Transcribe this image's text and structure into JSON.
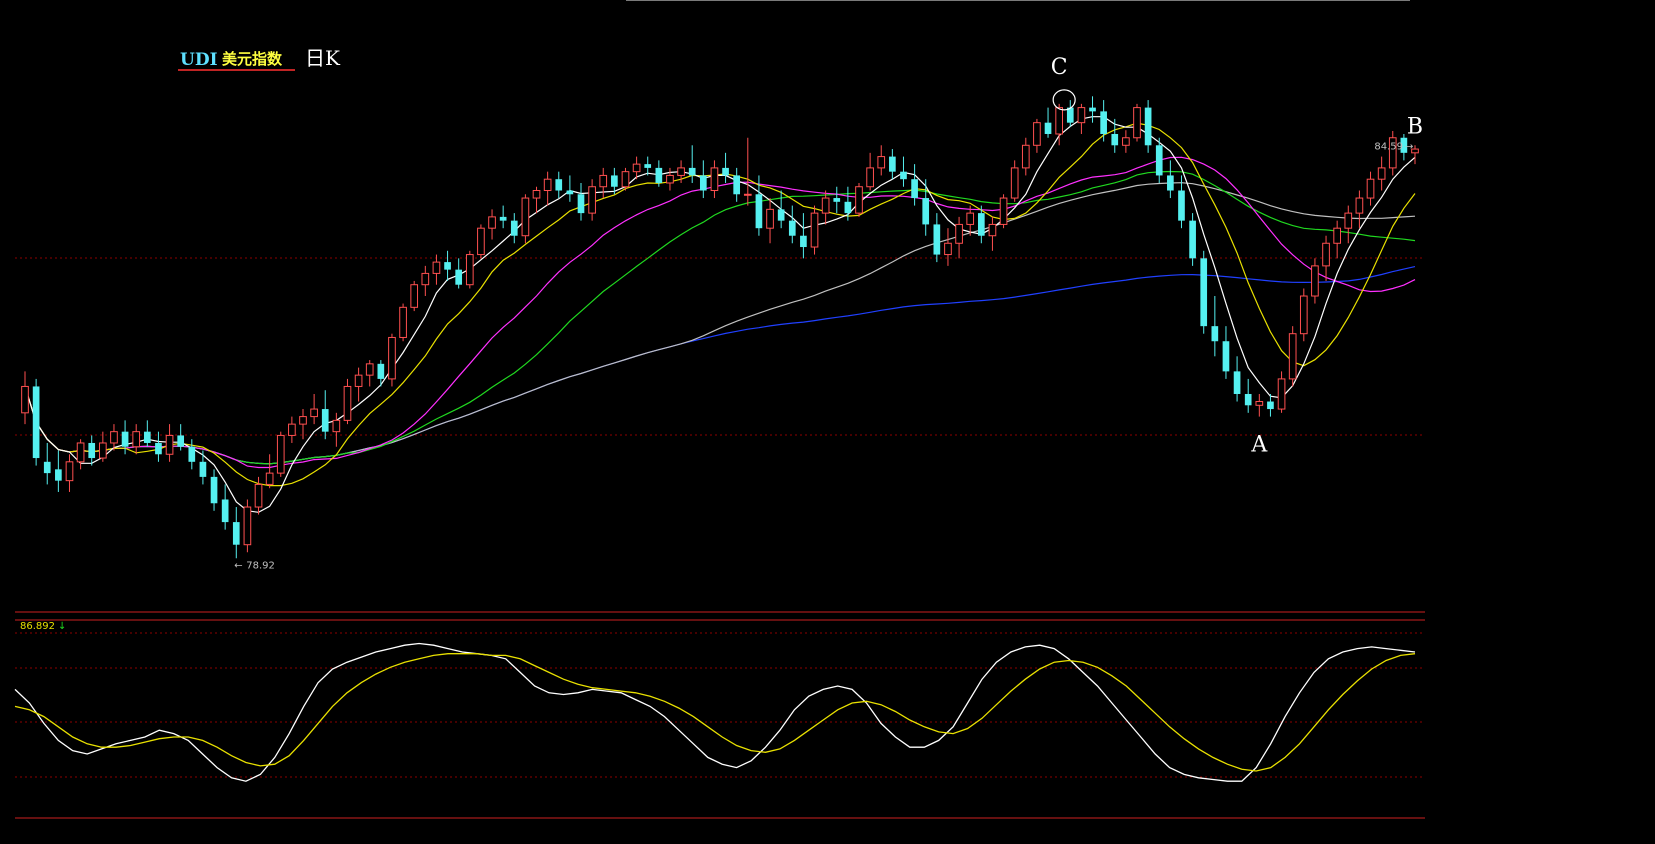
{
  "title": {
    "symbol": "UDI",
    "name": "美元指数",
    "period": "日K"
  },
  "colors": {
    "background": "#000000",
    "up": "#ff5050",
    "down": "#55f0f0",
    "grid": "#8b0000",
    "ma5": "#ffffff",
    "ma10": "#e8e000",
    "ma20": "#ff30ff",
    "ma30": "#20d820",
    "ma60": "#c0c0c0",
    "ma120": "#2040ff",
    "osc_fast": "#ffffff",
    "osc_slow": "#e8e000",
    "title_symbol": "#5ee0ff",
    "title_name": "#ffff40"
  },
  "chart_data": [
    {
      "type": "candlestick",
      "title": "UDI 美元指数 日K",
      "ylim": [
        78.3,
        85.2
      ],
      "annotations": {
        "max_label": "84.59",
        "min_label": "78.92",
        "points": [
          {
            "label": "C",
            "index": 93
          },
          {
            "label": "B",
            "index": 125
          },
          {
            "label": "A",
            "index": 111
          }
        ]
      },
      "ohlc": [
        [
          80.85,
          81.4,
          80.7,
          81.2
        ],
        [
          81.2,
          81.3,
          80.15,
          80.25
        ],
        [
          80.2,
          80.45,
          79.9,
          80.05
        ],
        [
          80.1,
          80.35,
          79.8,
          79.95
        ],
        [
          79.95,
          80.3,
          79.8,
          80.2
        ],
        [
          80.2,
          80.5,
          80.1,
          80.45
        ],
        [
          80.45,
          80.55,
          80.15,
          80.25
        ],
        [
          80.25,
          80.6,
          80.2,
          80.45
        ],
        [
          80.45,
          80.7,
          80.35,
          80.6
        ],
        [
          80.6,
          80.75,
          80.3,
          80.4
        ],
        [
          80.4,
          80.7,
          80.3,
          80.6
        ],
        [
          80.6,
          80.75,
          80.4,
          80.45
        ],
        [
          80.45,
          80.6,
          80.2,
          80.3
        ],
        [
          80.3,
          80.7,
          80.2,
          80.55
        ],
        [
          80.55,
          80.7,
          80.35,
          80.4
        ],
        [
          80.4,
          80.5,
          80.1,
          80.2
        ],
        [
          80.2,
          80.35,
          79.9,
          80.0
        ],
        [
          80.0,
          80.1,
          79.55,
          79.65
        ],
        [
          79.7,
          79.9,
          79.3,
          79.4
        ],
        [
          79.4,
          79.6,
          78.92,
          79.1
        ],
        [
          79.1,
          79.7,
          79.0,
          79.6
        ],
        [
          79.6,
          80.0,
          79.5,
          79.9
        ],
        [
          79.9,
          80.3,
          79.85,
          80.05
        ],
        [
          80.05,
          80.6,
          80.0,
          80.55
        ],
        [
          80.55,
          80.8,
          80.45,
          80.7
        ],
        [
          80.7,
          80.9,
          80.5,
          80.8
        ],
        [
          80.8,
          81.1,
          80.7,
          80.9
        ],
        [
          80.9,
          81.15,
          80.5,
          80.6
        ],
        [
          80.6,
          80.85,
          80.4,
          80.75
        ],
        [
          80.75,
          81.3,
          80.7,
          81.2
        ],
        [
          81.2,
          81.45,
          81.0,
          81.35
        ],
        [
          81.35,
          81.55,
          81.2,
          81.5
        ],
        [
          81.5,
          81.55,
          81.2,
          81.3
        ],
        [
          81.3,
          81.9,
          81.2,
          81.85
        ],
        [
          81.85,
          82.3,
          81.8,
          82.25
        ],
        [
          82.25,
          82.6,
          82.2,
          82.55
        ],
        [
          82.55,
          82.8,
          82.4,
          82.7
        ],
        [
          82.7,
          82.95,
          82.55,
          82.85
        ],
        [
          82.85,
          83.0,
          82.6,
          82.75
        ],
        [
          82.75,
          82.9,
          82.5,
          82.55
        ],
        [
          82.55,
          83.0,
          82.5,
          82.95
        ],
        [
          82.95,
          83.35,
          82.9,
          83.3
        ],
        [
          83.3,
          83.55,
          83.15,
          83.45
        ],
        [
          83.45,
          83.6,
          83.3,
          83.4
        ],
        [
          83.4,
          83.5,
          83.1,
          83.2
        ],
        [
          83.2,
          83.75,
          83.1,
          83.7
        ],
        [
          83.7,
          83.85,
          83.5,
          83.8
        ],
        [
          83.8,
          84.05,
          83.6,
          83.95
        ],
        [
          83.95,
          84.05,
          83.7,
          83.8
        ],
        [
          83.8,
          84.0,
          83.65,
          83.75
        ],
        [
          83.75,
          83.9,
          83.4,
          83.5
        ],
        [
          83.5,
          83.95,
          83.4,
          83.85
        ],
        [
          83.85,
          84.1,
          83.7,
          84.0
        ],
        [
          84.0,
          84.1,
          83.75,
          83.85
        ],
        [
          83.85,
          84.1,
          83.8,
          84.05
        ],
        [
          84.05,
          84.25,
          83.95,
          84.15
        ],
        [
          84.15,
          84.25,
          84.0,
          84.1
        ],
        [
          84.1,
          84.2,
          83.85,
          83.9
        ],
        [
          83.9,
          84.1,
          83.8,
          84.0
        ],
        [
          84.0,
          84.2,
          83.9,
          84.1
        ],
        [
          84.1,
          84.4,
          83.9,
          84.0
        ],
        [
          84.0,
          84.2,
          83.7,
          83.8
        ],
        [
          83.8,
          84.2,
          83.7,
          84.1
        ],
        [
          84.1,
          84.3,
          83.9,
          84.0
        ],
        [
          84.0,
          84.1,
          83.65,
          83.75
        ],
        [
          83.75,
          84.5,
          83.6,
          83.75
        ],
        [
          83.75,
          84.0,
          83.2,
          83.3
        ],
        [
          83.3,
          83.7,
          83.1,
          83.55
        ],
        [
          83.55,
          83.8,
          83.3,
          83.4
        ],
        [
          83.4,
          83.6,
          83.1,
          83.2
        ],
        [
          83.2,
          83.5,
          82.9,
          83.05
        ],
        [
          83.05,
          83.6,
          82.95,
          83.5
        ],
        [
          83.5,
          83.8,
          83.35,
          83.7
        ],
        [
          83.7,
          83.85,
          83.5,
          83.65
        ],
        [
          83.65,
          83.85,
          83.4,
          83.5
        ],
        [
          83.5,
          83.9,
          83.45,
          83.85
        ],
        [
          83.85,
          84.3,
          83.8,
          84.1
        ],
        [
          84.1,
          84.4,
          84.0,
          84.25
        ],
        [
          84.25,
          84.35,
          83.95,
          84.05
        ],
        [
          84.05,
          84.25,
          83.85,
          83.95
        ],
        [
          83.95,
          84.15,
          83.6,
          83.7
        ],
        [
          83.7,
          83.95,
          83.2,
          83.35
        ],
        [
          83.35,
          83.5,
          82.85,
          82.95
        ],
        [
          82.95,
          83.3,
          82.8,
          83.1
        ],
        [
          83.1,
          83.45,
          82.9,
          83.35
        ],
        [
          83.35,
          83.6,
          83.2,
          83.5
        ],
        [
          83.5,
          83.6,
          83.1,
          83.2
        ],
        [
          83.2,
          83.45,
          83.0,
          83.35
        ],
        [
          83.35,
          83.75,
          83.3,
          83.7
        ],
        [
          83.7,
          84.2,
          83.65,
          84.1
        ],
        [
          84.1,
          84.5,
          84.0,
          84.4
        ],
        [
          84.4,
          84.75,
          84.3,
          84.7
        ],
        [
          84.7,
          84.9,
          84.5,
          84.55
        ],
        [
          84.55,
          84.95,
          84.4,
          84.9
        ],
        [
          84.9,
          85.0,
          84.65,
          84.7
        ],
        [
          84.7,
          84.95,
          84.55,
          84.9
        ],
        [
          84.9,
          85.05,
          84.7,
          84.85
        ],
        [
          84.85,
          85.0,
          84.45,
          84.55
        ],
        [
          84.55,
          84.75,
          84.3,
          84.4
        ],
        [
          84.4,
          84.6,
          84.3,
          84.5
        ],
        [
          84.5,
          84.95,
          84.45,
          84.9
        ],
        [
          84.9,
          85.0,
          84.3,
          84.4
        ],
        [
          84.4,
          84.5,
          83.9,
          84.0
        ],
        [
          84.0,
          84.2,
          83.7,
          83.8
        ],
        [
          83.8,
          84.0,
          83.3,
          83.4
        ],
        [
          83.4,
          83.5,
          82.8,
          82.9
        ],
        [
          82.9,
          83.0,
          81.9,
          82.0
        ],
        [
          82.0,
          82.4,
          81.6,
          81.8
        ],
        [
          81.8,
          82.0,
          81.3,
          81.4
        ],
        [
          81.4,
          81.6,
          81.0,
          81.1
        ],
        [
          81.1,
          81.3,
          80.85,
          80.95
        ],
        [
          80.95,
          81.1,
          80.8,
          81.0
        ],
        [
          81.0,
          81.1,
          80.8,
          80.9
        ],
        [
          80.9,
          81.4,
          80.85,
          81.3
        ],
        [
          81.3,
          82.0,
          81.2,
          81.9
        ],
        [
          81.9,
          82.5,
          81.8,
          82.4
        ],
        [
          82.4,
          82.9,
          82.3,
          82.8
        ],
        [
          82.8,
          83.2,
          82.6,
          83.1
        ],
        [
          83.1,
          83.4,
          82.9,
          83.3
        ],
        [
          83.3,
          83.6,
          83.1,
          83.5
        ],
        [
          83.5,
          83.8,
          83.3,
          83.7
        ],
        [
          83.7,
          84.05,
          83.6,
          83.95
        ],
        [
          83.95,
          84.25,
          83.8,
          84.1
        ],
        [
          84.1,
          84.59,
          84.0,
          84.5
        ],
        [
          84.5,
          84.55,
          84.2,
          84.3
        ],
        [
          84.3,
          84.4,
          84.15,
          84.35
        ]
      ]
    },
    {
      "type": "line",
      "title": "",
      "indicator_value": "86.892",
      "ylim": [
        0,
        100
      ],
      "series": [
        {
          "values": [
            68,
            60,
            48,
            38,
            32,
            30,
            33,
            36,
            38,
            40,
            44,
            42,
            38,
            30,
            22,
            16,
            14,
            18,
            28,
            42,
            58,
            72,
            80,
            84,
            87,
            90,
            92,
            94,
            95,
            94,
            92,
            90,
            89,
            88,
            86,
            78,
            70,
            66,
            65,
            66,
            68,
            67,
            66,
            62,
            58,
            52,
            44,
            36,
            28,
            24,
            22,
            26,
            34,
            44,
            56,
            64,
            68,
            70,
            68,
            60,
            48,
            40,
            34,
            34,
            38,
            46,
            60,
            74,
            84,
            90,
            93,
            94,
            92,
            86,
            78,
            70,
            60,
            50,
            40,
            30,
            22,
            18,
            16,
            15,
            14,
            14,
            22,
            36,
            52,
            66,
            78,
            86,
            90,
            92,
            93,
            92,
            91,
            90
          ]
        },
        {
          "values": [
            58,
            56,
            52,
            46,
            40,
            36,
            34,
            34,
            35,
            37,
            39,
            40,
            40,
            38,
            34,
            29,
            25,
            23,
            24,
            29,
            38,
            48,
            58,
            66,
            72,
            77,
            81,
            84,
            86,
            88,
            89,
            89,
            89,
            88,
            88,
            86,
            82,
            78,
            74,
            71,
            69,
            68,
            67,
            66,
            64,
            61,
            57,
            52,
            46,
            40,
            35,
            32,
            31,
            33,
            38,
            44,
            50,
            56,
            60,
            61,
            59,
            55,
            50,
            46,
            43,
            42,
            45,
            51,
            59,
            67,
            74,
            80,
            84,
            85,
            84,
            81,
            76,
            70,
            62,
            54,
            46,
            39,
            33,
            28,
            24,
            21,
            20,
            22,
            28,
            36,
            46,
            56,
            65,
            73,
            80,
            85,
            88,
            89
          ]
        }
      ]
    }
  ]
}
